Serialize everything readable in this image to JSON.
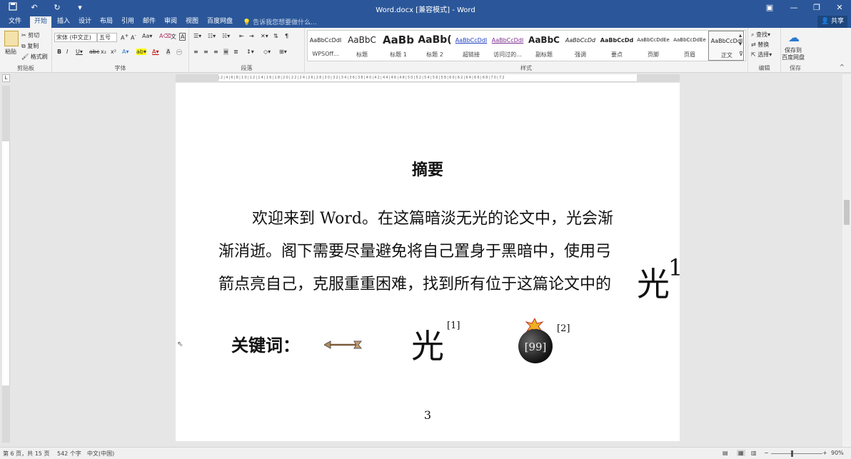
{
  "window": {
    "title": "Word.docx [兼容模式] - Word",
    "share_label": "共享"
  },
  "tabs": [
    "文件",
    "开始",
    "插入",
    "设计",
    "布局",
    "引用",
    "邮件",
    "审阅",
    "视图",
    "百度网盘"
  ],
  "tell_me": "告诉我您想要做什么...",
  "ribbon": {
    "clipboard": {
      "label": "剪贴板",
      "paste": "粘贴",
      "cut": "剪切",
      "copy": "复制",
      "format_painter": "格式刷"
    },
    "font": {
      "label": "字体",
      "font_name": "宋体 (中文正)",
      "font_size": "五号"
    },
    "paragraph": {
      "label": "段落"
    },
    "styles": {
      "label": "样式",
      "items": [
        {
          "preview": "AaBbCcDdI",
          "name": "WPSOff..."
        },
        {
          "preview": "AaBbC",
          "name": "标题"
        },
        {
          "preview": "AaBb",
          "name": "标题 1"
        },
        {
          "preview": "AaBb(",
          "name": "标题 2"
        },
        {
          "preview": "AaBbCcDdI",
          "name": "超链接"
        },
        {
          "preview": "AaBbCcDdI",
          "name": "访问过的..."
        },
        {
          "preview": "AaBbC",
          "name": "副标题"
        },
        {
          "preview": "AaBbCcDd",
          "name": "强调"
        },
        {
          "preview": "AaBbCcDd",
          "name": "要点"
        },
        {
          "preview": "AaBbCcDdEe",
          "name": "页脚"
        },
        {
          "preview": "AaBbCcDdEe",
          "name": "页眉"
        },
        {
          "preview": "AaBbCcDdI",
          "name": "正文"
        }
      ]
    },
    "editing": {
      "label": "编辑",
      "find": "查找",
      "replace": "替换",
      "select": "选择"
    },
    "save": {
      "label": "保存",
      "save_to": "保存到",
      "baidu": "百度网盘"
    }
  },
  "document": {
    "heading": "摘要",
    "paragraph_lines": [
      "欢迎来到 Word。在这篇暗淡无光的论文中，光会渐",
      "渐消逝。阁下需要尽量避免将自己置身于黑暗中，使用弓",
      "箭点亮自己，克服重重困难，找到所有位于这篇论文中的"
    ],
    "end_glyph": "光",
    "end_glyph_sup": "1",
    "keywords_label": "关键词：",
    "keyword_light": "光",
    "cite_1": "[1]",
    "bomb_text": "[99]",
    "cite_2": "[2]",
    "page_number": "3"
  },
  "status": {
    "page": "第 6 页，共 15 页",
    "words": "542 个字",
    "language": "中文(中国)",
    "zoom": "90%"
  }
}
